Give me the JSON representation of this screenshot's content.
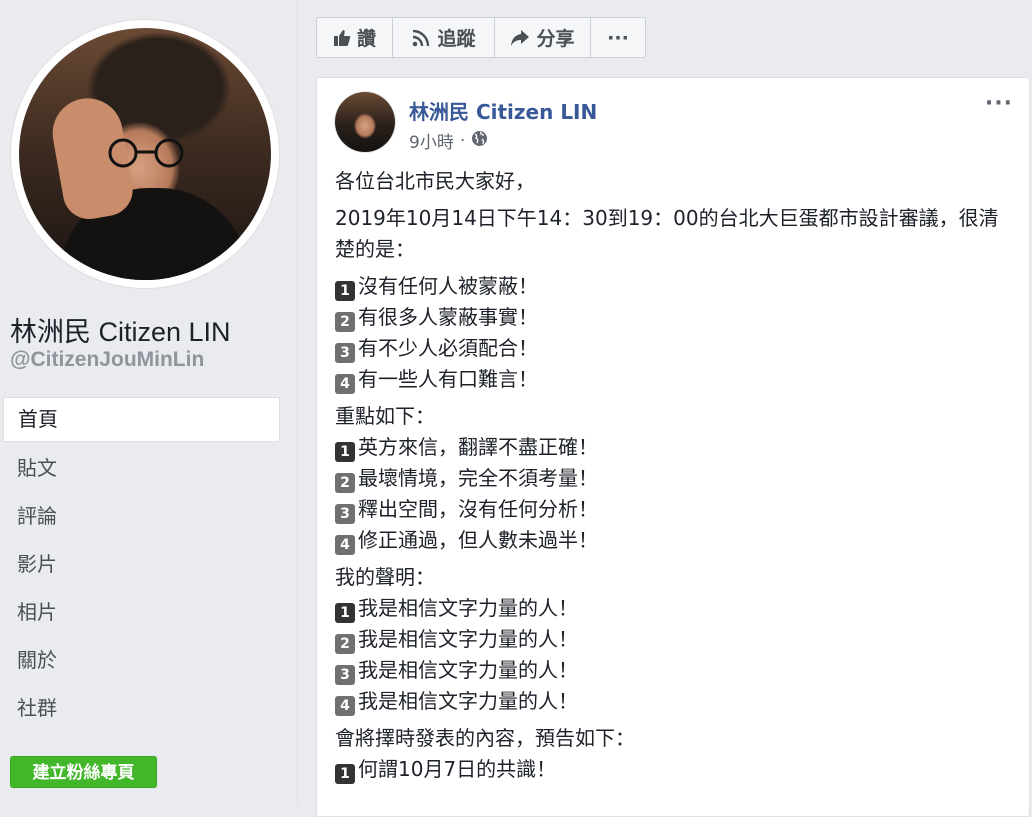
{
  "page": {
    "name": "林洲民 Citizen LIN",
    "handle": "@CitizenJouMinLin",
    "create_page_button": "建立粉絲專頁"
  },
  "nav": [
    {
      "label": "首頁",
      "active": true
    },
    {
      "label": "貼文"
    },
    {
      "label": "評論"
    },
    {
      "label": "影片"
    },
    {
      "label": "相片"
    },
    {
      "label": "關於"
    },
    {
      "label": "社群"
    }
  ],
  "actions": {
    "like": "讚",
    "follow": "追蹤",
    "share": "分享",
    "more": "···"
  },
  "post": {
    "author": "林洲民 Citizen LIN",
    "time": "9小時",
    "more": "···",
    "greeting": "各位台北市民大家好，",
    "intro": "2019年10月14日下午14：30到19：00的台北大巨蛋都市設計審議，很清楚的是：",
    "list1": [
      "沒有任何人被蒙蔽！",
      "有很多人蒙蔽事實！",
      "有不少人必須配合！",
      "有一些人有口難言！"
    ],
    "heading2": "重點如下：",
    "list2": [
      "英方來信，翻譯不盡正確！",
      "最壞情境，完全不須考量！",
      "釋出空間，沒有任何分析！",
      "修正通過，但人數未過半！"
    ],
    "heading3": "我的聲明：",
    "list3": [
      "我是相信文字力量的人！",
      "我是相信文字力量的人！",
      "我是相信文字力量的人！",
      "我是相信文字力量的人！"
    ],
    "heading4": "會將擇時發表的內容，預告如下：",
    "list4": [
      "何謂10月7日的共識！"
    ],
    "numbers": [
      "1",
      "2",
      "3",
      "4"
    ]
  }
}
